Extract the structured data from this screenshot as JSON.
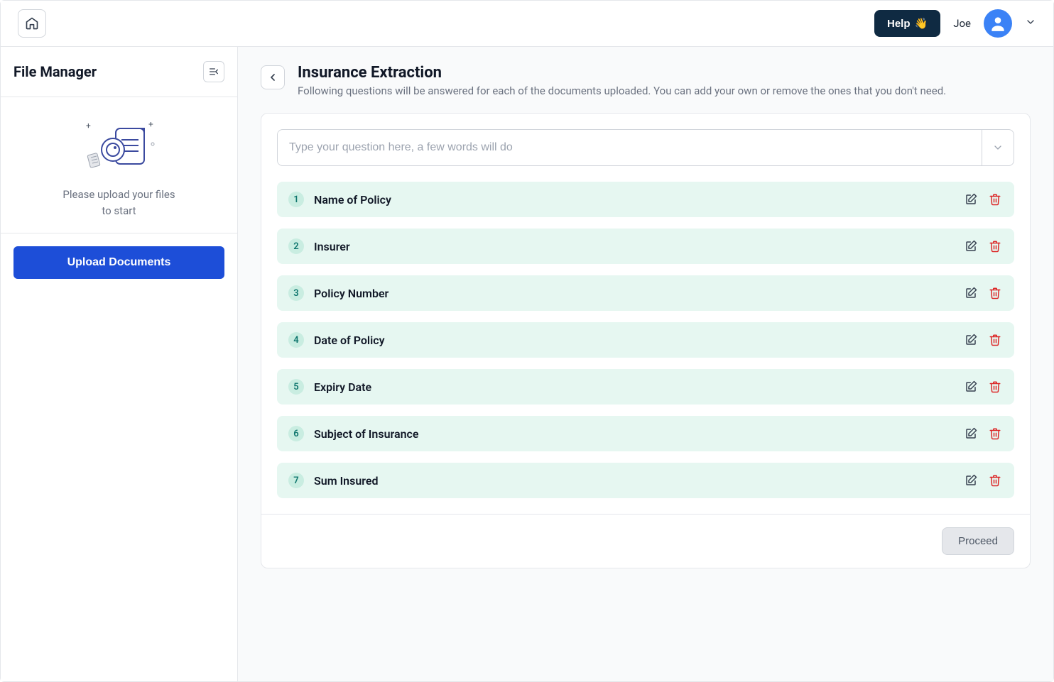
{
  "topbar": {
    "help_label": "Help",
    "user_name": "Joe"
  },
  "sidebar": {
    "title": "File Manager",
    "upload_hint_line1": "Please upload your files",
    "upload_hint_line2": "to start",
    "upload_button": "Upload Documents"
  },
  "main": {
    "title": "Insurance Extraction",
    "subtitle": "Following questions will be answered for each of the documents uploaded. You can add your own or remove the ones that you don't need.",
    "question_placeholder": "Type your question here, a few words will do",
    "questions": [
      {
        "num": "1",
        "label": "Name of Policy"
      },
      {
        "num": "2",
        "label": "Insurer"
      },
      {
        "num": "3",
        "label": "Policy Number"
      },
      {
        "num": "4",
        "label": "Date of Policy"
      },
      {
        "num": "5",
        "label": "Expiry Date"
      },
      {
        "num": "6",
        "label": "Subject of Insurance"
      },
      {
        "num": "7",
        "label": "Sum Insured"
      }
    ],
    "proceed_label": "Proceed"
  }
}
